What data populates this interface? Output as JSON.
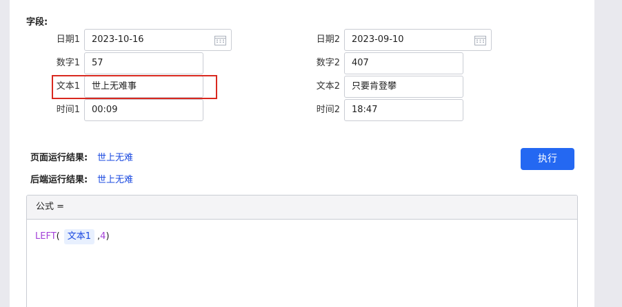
{
  "section_title": "字段:",
  "fields": {
    "date1": {
      "label": "日期1",
      "value": "2023-10-16"
    },
    "date2": {
      "label": "日期2",
      "value": "2023-09-10"
    },
    "num1": {
      "label": "数字1",
      "value": "57"
    },
    "num2": {
      "label": "数字2",
      "value": "407"
    },
    "text1": {
      "label": "文本1",
      "value": "世上无难事"
    },
    "text2": {
      "label": "文本2",
      "value": "只要肯登攀"
    },
    "time1": {
      "label": "时间1",
      "value": "00:09"
    },
    "time2": {
      "label": "时间2",
      "value": "18:47"
    }
  },
  "results": {
    "page_label": "页面运行结果:",
    "page_value": "世上无难",
    "backend_label": "后端运行结果:",
    "backend_value": "世上无难"
  },
  "run_button": "执行",
  "formula": {
    "header": "公式 =",
    "fn": "LEFT",
    "open_paren": "(",
    "arg_var": "文本1",
    "comma": ",",
    "arg_num": "4",
    "close_paren": ")"
  },
  "colors": {
    "accent": "#2468f2",
    "highlight": "#d9281e",
    "result_text": "#1a49e0",
    "function_text": "#a340d8"
  },
  "icons": {
    "date_picker": "calendar-icon"
  }
}
